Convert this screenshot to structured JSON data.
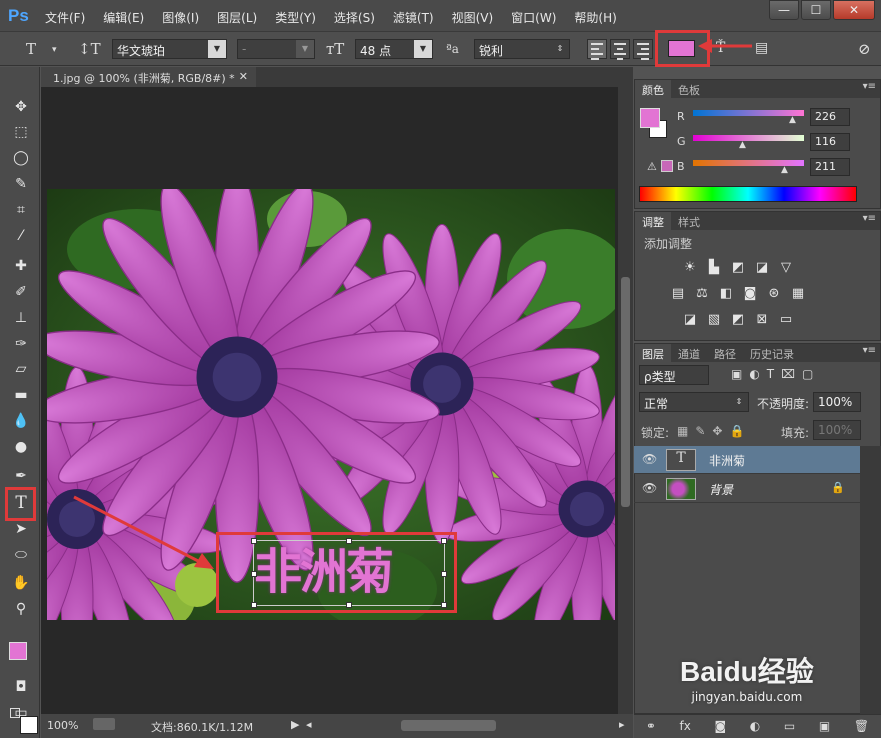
{
  "app": {
    "logo": "Ps"
  },
  "menu": [
    "文件(F)",
    "编辑(E)",
    "图像(I)",
    "图层(L)",
    "类型(Y)",
    "选择(S)",
    "滤镜(T)",
    "视图(V)",
    "窗口(W)",
    "帮助(H)"
  ],
  "window_buttons": [
    "—",
    "☐",
    "✕"
  ],
  "options": {
    "font_family": "华文琥珀",
    "font_style": "-",
    "font_size": "48 点",
    "aa_label": "ªa",
    "antialias": "锐利",
    "text_color": "#e274d3"
  },
  "document": {
    "tab_title": "1.jpg @ 100% (非洲菊, RGB/8#) *",
    "canvas_text": "非洲菊",
    "text_color": "#e274d3"
  },
  "status": {
    "zoom": "100%",
    "doc_info": "文档:860.1K/1.12M"
  },
  "color_panel": {
    "tabs": [
      "颜色",
      "色板"
    ],
    "channels": [
      {
        "label": "R",
        "value": "226"
      },
      {
        "label": "G",
        "value": "116"
      },
      {
        "label": "B",
        "value": "211"
      }
    ],
    "foreground": "#e274d3"
  },
  "adjust_panel": {
    "tabs": [
      "调整",
      "样式"
    ],
    "title": "添加调整"
  },
  "layers_panel": {
    "tabs": [
      "图层",
      "通道",
      "路径",
      "历史记录"
    ],
    "filter_label": "ρ类型",
    "blend_mode": "正常",
    "opacity_label": "不透明度:",
    "opacity": "100%",
    "lock_label": "锁定:",
    "fill_label": "填充:",
    "fill": "100%",
    "layers": [
      {
        "name": "非洲菊",
        "thumb": "T",
        "selected": true
      },
      {
        "name": "背景",
        "thumb": "",
        "selected": false
      }
    ]
  },
  "watermark": {
    "brand": "Baidu经验",
    "url": "jingyan.baidu.com"
  }
}
